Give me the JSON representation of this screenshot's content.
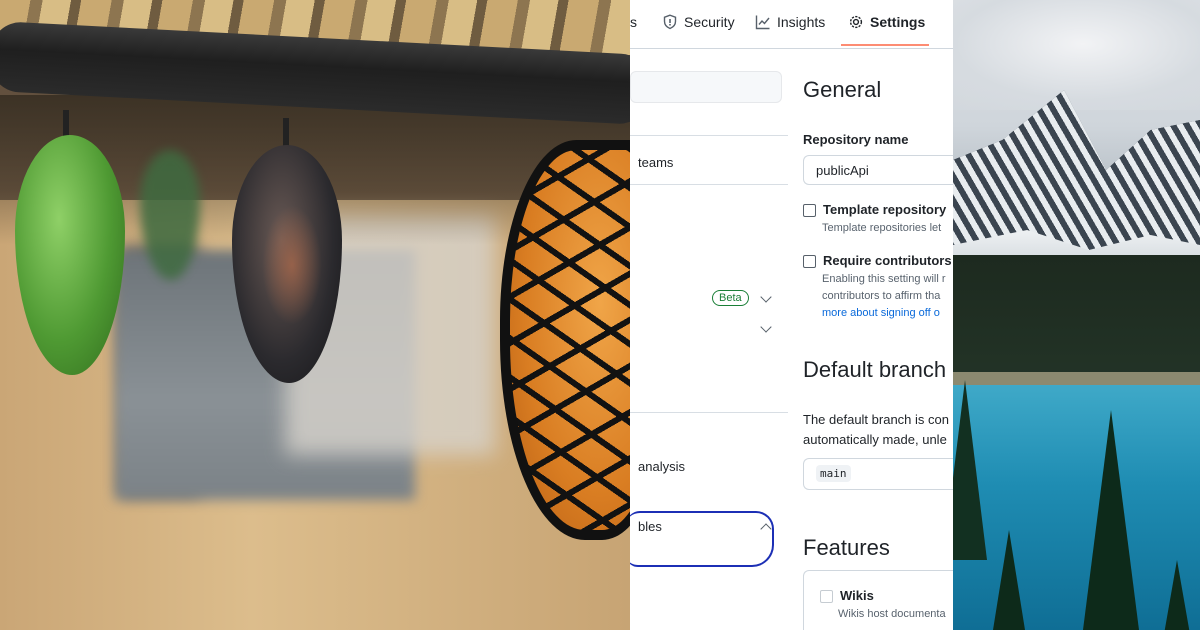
{
  "nav": {
    "code_tab_fragment": "s",
    "security_label": "Security",
    "insights_label": "Insights",
    "settings_label": "Settings"
  },
  "sidebar": {
    "items": [
      {
        "label": "teams"
      },
      {
        "label": "Beta"
      },
      {
        "label": "analysis"
      },
      {
        "label": "bles"
      }
    ]
  },
  "main": {
    "general_heading": "General",
    "repo_name_label": "Repository name",
    "repo_name_value": "publicApi",
    "template_repo_label": "Template repository",
    "template_repo_note": "Template repositories let",
    "require_contrib_label": "Require contributors",
    "require_contrib_note_1": "Enabling this setting will r",
    "require_contrib_note_2": "contributors to affirm tha",
    "require_contrib_link": "more about signing off o",
    "default_branch_heading": "Default branch",
    "default_branch_desc_1": "The default branch is con",
    "default_branch_desc_2": "automatically made, unle",
    "default_branch_value": "main",
    "features_heading": "Features",
    "wikis_label": "Wikis",
    "wikis_note": "Wikis host documenta"
  },
  "colors": {
    "tab_underline": "#fd8c73",
    "beta_badge": "#1a7f37",
    "link": "#0969da",
    "annotation_ink": "#1c2fb5"
  }
}
